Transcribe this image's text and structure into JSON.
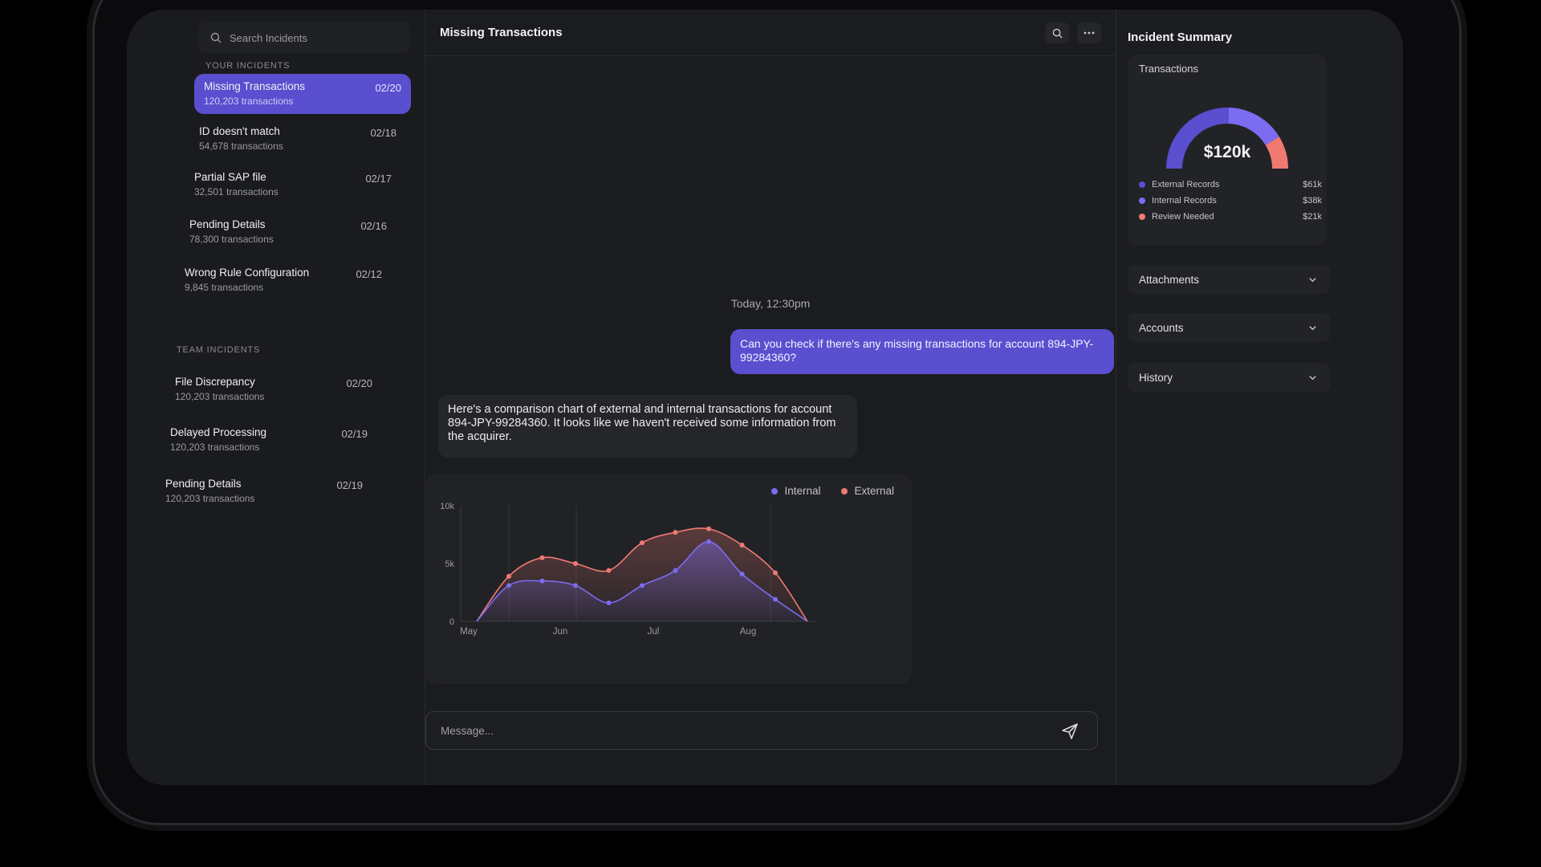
{
  "sidebar": {
    "search_placeholder": "Search Incidents",
    "your_incidents_label": "YOUR INCIDENTS",
    "your_incidents": [
      {
        "name": "Missing Transactions",
        "count": "120,203 transactions",
        "date": "02/20"
      },
      {
        "name": "ID doesn't match",
        "count": "54,678 transactions",
        "date": "02/18"
      },
      {
        "name": "Partial SAP file",
        "count": "32,501 transactions",
        "date": "02/17"
      },
      {
        "name": "Pending Details",
        "count": "78,300 transactions",
        "date": "02/16"
      },
      {
        "name": "Wrong Rule Configuration",
        "count": "9,845 transactions",
        "date": "02/12"
      }
    ],
    "team_incidents_label": "TEAM INCIDENTS",
    "team_incidents": [
      {
        "name": "File Discrepancy",
        "count": "120,203 transactions",
        "date": "02/20"
      },
      {
        "name": "Delayed Processing",
        "count": "120,203 transactions",
        "date": "02/19"
      },
      {
        "name": "Pending Details",
        "count": "120,203 transactions",
        "date": "02/19"
      }
    ]
  },
  "main": {
    "title": "Missing Transactions",
    "timestamp": "Today, 12:30pm",
    "user_message": "Can you check if there's any missing transactions for account 894-JPY-99284360?",
    "bot_message": "Here's a comparison chart of external and internal transactions for account 894-JPY-99284360. It looks like we haven't received some information from the acquirer.",
    "composer_placeholder": "Message..."
  },
  "chart_data": {
    "type": "area",
    "x_ticks": [
      "May",
      "Jun",
      "Jul",
      "Aug"
    ],
    "y_ticks": [
      "0",
      "5k",
      "10k"
    ],
    "ylim": [
      0,
      10000
    ],
    "legend_position": "top-right",
    "series": [
      {
        "name": "Internal",
        "color": "#7b6cf0",
        "values": [
          3100,
          3500,
          3100,
          1600,
          3100,
          4400,
          6900,
          4100,
          1900
        ]
      },
      {
        "name": "External",
        "color": "#f07a72",
        "values": [
          3900,
          5500,
          5000,
          4400,
          6800,
          7700,
          8000,
          6600,
          4200
        ]
      }
    ]
  },
  "right": {
    "heading": "Incident Summary",
    "transactions_label": "Transactions",
    "total": "$120k",
    "breakdown": [
      {
        "label": "External Records",
        "amount": "$61k",
        "value": 61,
        "color": "#5a4fcf"
      },
      {
        "label": "Internal Records",
        "amount": "$38k",
        "value": 38,
        "color": "#7b6cf0"
      },
      {
        "label": "Review Needed",
        "amount": "$21k",
        "value": 21,
        "color": "#f07a72"
      }
    ],
    "sections": [
      "Attachments",
      "Accounts",
      "History"
    ]
  }
}
